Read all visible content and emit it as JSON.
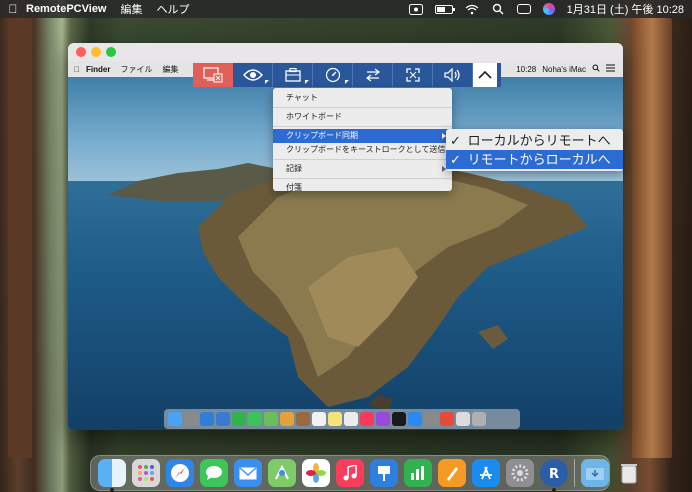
{
  "menubar": {
    "app_name": "RemotePCView",
    "items": [
      "編集",
      "ヘルプ"
    ],
    "clock": "1月31日 (土)  午後 10:28"
  },
  "remote": {
    "menubar": {
      "app": "Finder",
      "items": [
        "ファイル",
        "編集"
      ],
      "time": "10:28",
      "computer": "Noha's iMac"
    }
  },
  "toolbar": {
    "buttons": [
      {
        "name": "disconnect",
        "icon": "disconnect-icon"
      },
      {
        "name": "view",
        "icon": "eye-icon"
      },
      {
        "name": "actions",
        "icon": "toolbox-icon"
      },
      {
        "name": "quality",
        "icon": "speedometer-icon"
      },
      {
        "name": "transfer",
        "icon": "transfer-arrows-icon"
      },
      {
        "name": "fullscreen",
        "icon": "fullscreen-icon"
      },
      {
        "name": "sound",
        "icon": "speaker-icon"
      },
      {
        "name": "collapse",
        "icon": "chevron-up-icon"
      }
    ]
  },
  "dropdown": {
    "chat": "チャット",
    "whiteboard": "ホワイトボード",
    "clipboard_sync": "クリップボード同期",
    "send_keystrokes": "クリップボードをキーストロークとして送信",
    "record": "記録",
    "notes": "付箋"
  },
  "submenu": {
    "local_to_remote": "ローカルからリモートへ",
    "remote_to_local": "リモートからローカルへ",
    "check": "✓"
  },
  "colors": {
    "toolbar_bg": "#2a579a",
    "disconnect_bg": "#e05f57",
    "selection": "#2d6bd4"
  },
  "dock_icons": [
    "finder",
    "launchpad",
    "safari",
    "messages",
    "mail",
    "maps",
    "photos",
    "music",
    "keynote",
    "numbers",
    "pages",
    "app-store",
    "system-preferences",
    "remotepc",
    "downloads",
    "trash"
  ]
}
